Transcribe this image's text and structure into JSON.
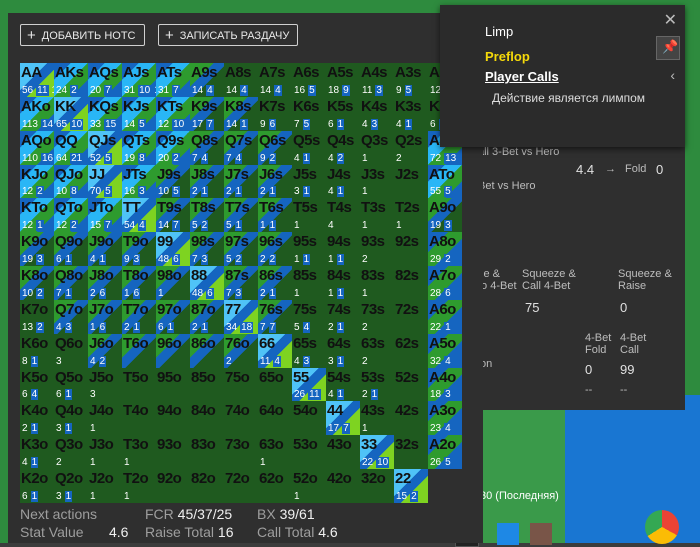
{
  "toolbar": {
    "add_note": "ДОБАВИТЬ НОТС",
    "record_hand": "ЗАПИСАТЬ РАЗДАЧУ"
  },
  "popup": {
    "title": "Limp",
    "street": "Preflop",
    "player_calls": "Player Calls",
    "description": "Действие является лимпом"
  },
  "behind": {
    "l1": "all 3-Bet vs Hero",
    "l2": "Bet vs Hero",
    "v1": "4.4",
    "arrow1": "→",
    "fold1": "Fold",
    "fold1v": "0",
    "squeeze4bet": "Squeeze & Call 4-Bet",
    "squeezeRaise": "Squeeze & Raise",
    "v75": "75",
    "v0": "0",
    "fold4bet": "4-Bet Fold",
    "call4bet": "4-Bet Call",
    "v0b": "0",
    "v99": "99",
    "dash": "--",
    "last": "30 (Последняя)",
    "z4bet": "ze &\nto 4-Bet",
    "on": "on"
  },
  "footer": {
    "next_actions_label": "Next actions",
    "fcr_label": "FCR",
    "fcr_value": "45/37/25",
    "bx_label": "BX",
    "bx_value": "39/61",
    "stat_label": "Stat Value",
    "stat_value": "4.6",
    "raise_label": "Raise Total",
    "raise_value": "16",
    "call_label": "Call Total",
    "call_value": "4.6"
  },
  "colors": {
    "blue": "#1565c0",
    "cyan": "#29b6f6",
    "lightcyan": "#4fc3f7",
    "green": "#2e9b2e",
    "lime": "#7ed321",
    "darkgreen": "#1f5a1f",
    "yellow": "#e6e62e"
  },
  "grid": [
    [
      [
        "AA",
        "56",
        "11",
        "1"
      ],
      [
        "AKs",
        "24",
        "2"
      ],
      [
        "AQs",
        "20",
        "7"
      ],
      [
        "AJs",
        "31",
        "10",
        "1"
      ],
      [
        "ATs",
        "31",
        "7"
      ],
      [
        "A9s",
        "14",
        "4"
      ],
      [
        "A8s",
        "14",
        "4"
      ],
      [
        "A7s",
        "14",
        "4"
      ],
      [
        "A6s",
        "16",
        "5"
      ],
      [
        "A5s",
        "18",
        "9"
      ],
      [
        "A4s",
        "11",
        "3"
      ],
      [
        "A3s",
        "9",
        "5"
      ],
      [
        "A2s",
        "12",
        "3"
      ]
    ],
    [
      [
        "AKo",
        "113",
        "14"
      ],
      [
        "KK",
        "65",
        "10"
      ],
      [
        "KQs",
        "33",
        "15"
      ],
      [
        "KJs",
        "14",
        "5"
      ],
      [
        "KTs",
        "12",
        "10"
      ],
      [
        "K9s",
        "17",
        "7"
      ],
      [
        "K8s",
        "14",
        "1"
      ],
      [
        "K7s",
        "9",
        "6"
      ],
      [
        "K6s",
        "7",
        "5"
      ],
      [
        "K5s",
        "6",
        "1"
      ],
      [
        "K4s",
        "4",
        "3"
      ],
      [
        "K3s",
        "4",
        "1"
      ],
      [
        "K2s",
        "6",
        "3"
      ]
    ],
    [
      [
        "AQo",
        "110",
        "16"
      ],
      [
        "QQ",
        "64",
        "21"
      ],
      [
        "QJs",
        "52",
        "5"
      ],
      [
        "QTs",
        "19",
        "8"
      ],
      [
        "Q9s",
        "20",
        "2"
      ],
      [
        "Q8s",
        "7",
        "4"
      ],
      [
        "Q7s",
        "7",
        "4"
      ],
      [
        "Q6s",
        "9",
        "2"
      ],
      [
        "Q5s",
        "4",
        "1"
      ],
      [
        "Q4s",
        "4",
        "2"
      ],
      [
        "Q3s",
        "1"
      ],
      [
        "Q2s",
        "2"
      ]
    ],
    [
      [
        "AJo",
        "72",
        "13"
      ],
      [
        "KJo",
        "12",
        "2"
      ],
      [
        "QJo",
        "10",
        "8"
      ],
      [
        "JJ",
        "70",
        "5"
      ],
      [
        "JTs",
        "16",
        "3"
      ],
      [
        "J9s",
        "10",
        "5"
      ],
      [
        "J8s",
        "2",
        "1"
      ],
      [
        "J7s",
        "2",
        "1"
      ],
      [
        "J6s",
        "2",
        "1"
      ],
      [
        "J5s",
        "3",
        "1"
      ],
      [
        "J4s",
        "4",
        "1"
      ],
      [
        "J3s",
        "1"
      ],
      [
        "J2s",
        ""
      ]
    ],
    [
      [
        "ATo",
        "55",
        "5"
      ],
      [
        "KTo",
        "12",
        "1"
      ],
      [
        "QTo",
        "12",
        "2"
      ],
      [
        "JTo",
        "15",
        "7"
      ],
      [
        "TT",
        "54",
        "4"
      ],
      [
        "T9s",
        "14",
        "7"
      ],
      [
        "T8s",
        "5",
        "2"
      ],
      [
        "T7s",
        "5",
        "1"
      ],
      [
        "T6s",
        "1",
        "1"
      ],
      [
        "T5s",
        "1"
      ],
      [
        "T4s",
        "4"
      ],
      [
        "T3s",
        "1"
      ],
      [
        "T2s",
        "1"
      ]
    ],
    [
      [
        "A9o",
        "19",
        "3"
      ],
      [
        "K9o",
        "19",
        "3"
      ],
      [
        "Q9o",
        "6",
        "1"
      ],
      [
        "J9o",
        "4",
        "1"
      ],
      [
        "T9o",
        "9",
        "3"
      ],
      [
        "99",
        "48",
        "6"
      ],
      [
        "98s",
        "7",
        "3"
      ],
      [
        "97s",
        "5",
        "2"
      ],
      [
        "96s",
        "2",
        "2"
      ],
      [
        "95s",
        "1",
        "1"
      ],
      [
        "94s",
        "1",
        "1"
      ],
      [
        "93s",
        "2"
      ],
      [
        "92s",
        ""
      ]
    ],
    [
      [
        "A8o",
        "29",
        "2"
      ],
      [
        "K8o",
        "10",
        "2"
      ],
      [
        "Q8o",
        "7",
        "1"
      ],
      [
        "J8o",
        "2",
        "6"
      ],
      [
        "T8o",
        "1",
        "6"
      ],
      [
        "98o",
        "1"
      ],
      [
        "88",
        "48",
        "6"
      ],
      [
        "87s",
        "7",
        "3"
      ],
      [
        "86s",
        "2",
        "1"
      ],
      [
        "85s",
        "1"
      ],
      [
        "84s",
        "1",
        "1"
      ],
      [
        "83s",
        "1"
      ],
      [
        "82s",
        ""
      ]
    ],
    [
      [
        "A7o",
        "28",
        "6"
      ],
      [
        "K7o",
        "13",
        "2"
      ],
      [
        "Q7o",
        "4",
        "3"
      ],
      [
        "J7o",
        "1",
        "6"
      ],
      [
        "T7o",
        "2",
        "1"
      ],
      [
        "97o",
        "6",
        "1"
      ],
      [
        "87o",
        "2",
        "1"
      ],
      [
        "77",
        "34",
        "18"
      ],
      [
        "76s",
        "7",
        "7"
      ],
      [
        "75s",
        "5",
        "4"
      ],
      [
        "74s",
        "2",
        "1"
      ],
      [
        "73s",
        "2"
      ],
      [
        "72s",
        ""
      ]
    ],
    [
      [
        "A6o",
        "22",
        "1"
      ],
      [
        "K6o",
        "8",
        "1"
      ],
      [
        "Q6o",
        "3",
        ""
      ],
      [
        "J6o",
        "4",
        "2"
      ],
      [
        "T6o",
        ""
      ],
      [
        "96o",
        ""
      ],
      [
        "86o",
        ""
      ],
      [
        "76o",
        "2"
      ],
      [
        "66",
        "11",
        "4"
      ],
      [
        "65s",
        "4",
        "3"
      ],
      [
        "64s",
        "3",
        "1"
      ],
      [
        "63s",
        "2"
      ],
      [
        "62s",
        ""
      ]
    ],
    [
      [
        "A5o",
        "32",
        "4"
      ],
      [
        "K5o",
        "6",
        "4"
      ],
      [
        "Q5o",
        "6",
        "1"
      ],
      [
        "J5o",
        "3"
      ],
      [
        "T5o",
        ""
      ],
      [
        "95o",
        ""
      ],
      [
        "85o",
        ""
      ],
      [
        "75o",
        ""
      ],
      [
        "65o",
        ""
      ],
      [
        "55",
        "26",
        "11"
      ],
      [
        "54s",
        "4",
        "1"
      ],
      [
        "53s",
        "2",
        "1"
      ],
      [
        "52s",
        ""
      ]
    ],
    [
      [
        "A4o",
        "18",
        "3"
      ],
      [
        "K4o",
        "2",
        "1"
      ],
      [
        "Q4o",
        "3",
        "1"
      ],
      [
        "J4o",
        "1"
      ],
      [
        "T4o",
        ""
      ],
      [
        "94o",
        ""
      ],
      [
        "84o",
        ""
      ],
      [
        "74o",
        ""
      ],
      [
        "64o",
        ""
      ],
      [
        "54o",
        ""
      ],
      [
        "44",
        "17",
        "7"
      ],
      [
        "43s",
        "1"
      ],
      [
        "42s",
        ""
      ]
    ],
    [
      [
        "A3o",
        "23",
        "4"
      ],
      [
        "K3o",
        "4",
        "1"
      ],
      [
        "Q3o",
        "2",
        ""
      ],
      [
        "J3o",
        "1"
      ],
      [
        "T3o",
        "1"
      ],
      [
        "93o",
        ""
      ],
      [
        "83o",
        ""
      ],
      [
        "73o",
        ""
      ],
      [
        "63o",
        "1"
      ],
      [
        "53o",
        ""
      ],
      [
        "43o",
        ""
      ],
      [
        "33",
        "22",
        "10"
      ],
      [
        "32s",
        ""
      ]
    ],
    [
      [
        "A2o",
        "26",
        "5"
      ],
      [
        "K2o",
        "6",
        "1"
      ],
      [
        "Q2o",
        "3",
        "1"
      ],
      [
        "J2o",
        "1"
      ],
      [
        "T2o",
        "1"
      ],
      [
        "92o",
        ""
      ],
      [
        "82o",
        ""
      ],
      [
        "72o",
        ""
      ],
      [
        "62o",
        ""
      ],
      [
        "52o",
        "1"
      ],
      [
        "42o",
        ""
      ],
      [
        "32o",
        ""
      ],
      [
        "22",
        "15",
        "2"
      ]
    ]
  ]
}
